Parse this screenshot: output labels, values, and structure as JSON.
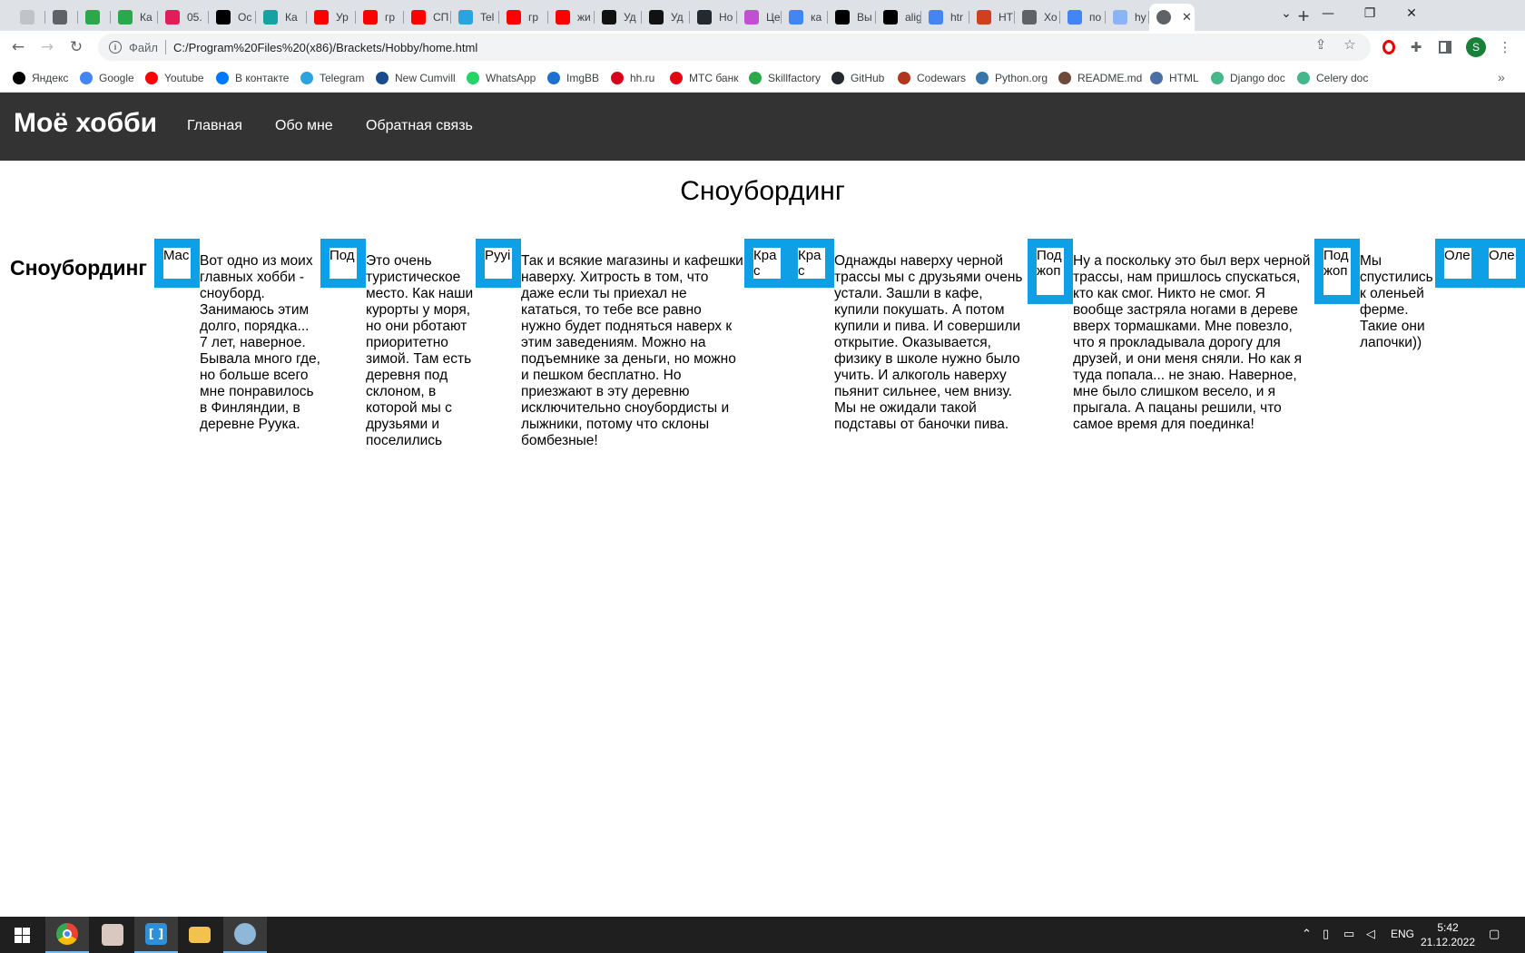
{
  "browser": {
    "tabs": [
      {
        "title": "",
        "icon": "app-icon",
        "color": "#c0c4c8"
      },
      {
        "title": "",
        "icon": "globe-icon",
        "color": "#5f6368"
      },
      {
        "title": "",
        "icon": "skillfactory-icon",
        "color": "#2ba84a"
      },
      {
        "title": "Ка",
        "icon": "skillfactory-icon",
        "color": "#2ba84a"
      },
      {
        "title": "05.",
        "icon": "slack-icon",
        "color": "#e01e5a"
      },
      {
        "title": "Ос",
        "icon": "medium-icon",
        "color": "#000000"
      },
      {
        "title": "Ка",
        "icon": "app-icon",
        "color": "#14a3a0"
      },
      {
        "title": "Ур",
        "icon": "youtube-icon",
        "color": "#ff0000"
      },
      {
        "title": "гр",
        "icon": "youtube-icon",
        "color": "#ff0000"
      },
      {
        "title": "СП",
        "icon": "youtube-icon",
        "color": "#ff0000"
      },
      {
        "title": "Tel",
        "icon": "telegram-icon",
        "color": "#2aa3df"
      },
      {
        "title": "гр",
        "icon": "youtube-icon",
        "color": "#ff0000"
      },
      {
        "title": "жи",
        "icon": "youtube-icon",
        "color": "#ff0000"
      },
      {
        "title": "Уд",
        "icon": "wp-icon",
        "color": "#111111"
      },
      {
        "title": "Уд",
        "icon": "wp-icon",
        "color": "#111111"
      },
      {
        "title": "Но",
        "icon": "github-icon",
        "color": "#24292f"
      },
      {
        "title": "Це",
        "icon": "color-wheel-icon",
        "color": "#c050d0"
      },
      {
        "title": "ка",
        "icon": "google-icon",
        "color": "#4285f4"
      },
      {
        "title": "Вы",
        "icon": "medium-icon",
        "color": "#000000"
      },
      {
        "title": "alig",
        "icon": "medium-icon",
        "color": "#000000"
      },
      {
        "title": "htr",
        "icon": "google-icon",
        "color": "#4285f4"
      },
      {
        "title": "HT",
        "icon": "html-icon",
        "color": "#d04020"
      },
      {
        "title": "Хо",
        "icon": "globe-icon",
        "color": "#5f6368"
      },
      {
        "title": "по",
        "icon": "google-icon",
        "color": "#4285f4"
      },
      {
        "title": "hy",
        "icon": "loading-icon",
        "color": "#8ab4f8"
      }
    ],
    "active_tab": {
      "icon": "globe-icon",
      "close": "✕"
    },
    "window": {
      "minimize": "—",
      "maximize": "❐",
      "close": "✕",
      "tab_search": "⌄",
      "new_tab": "+"
    },
    "address": {
      "scheme_label": "Файл",
      "url": "C:/Program%20Files%20(x86)/Brackets/Hobby/home.html"
    },
    "profile_letter": "S",
    "bookmarks": [
      {
        "label": "Яндекс",
        "icon": "yandex-icon",
        "color": "#000000"
      },
      {
        "label": "Google",
        "icon": "google-icon",
        "color": "#4285f4"
      },
      {
        "label": "Youtube",
        "icon": "youtube-icon",
        "color": "#ff0000"
      },
      {
        "label": "В контакте",
        "icon": "vk-icon",
        "color": "#0077ff"
      },
      {
        "label": "Telegram",
        "icon": "telegram-icon",
        "color": "#2aa3df"
      },
      {
        "label": "New Cumvill",
        "icon": "cumvill-icon",
        "color": "#1a4b8c"
      },
      {
        "label": "WhatsApp",
        "icon": "whatsapp-icon",
        "color": "#25d366"
      },
      {
        "label": "ImgBB",
        "icon": "imgbb-icon",
        "color": "#1d6fd1"
      },
      {
        "label": "hh.ru",
        "icon": "hh-icon",
        "color": "#d6001c"
      },
      {
        "label": "МТС банк",
        "icon": "mts-icon",
        "color": "#e30611"
      },
      {
        "label": "Skillfactory",
        "icon": "skillfactory-icon",
        "color": "#2ba84a"
      },
      {
        "label": "GitHub",
        "icon": "github-icon",
        "color": "#24292f"
      },
      {
        "label": "Codewars",
        "icon": "codewars-icon",
        "color": "#b1361e"
      },
      {
        "label": "Python.org",
        "icon": "python-icon",
        "color": "#3776ab"
      },
      {
        "label": "README.md",
        "icon": "readme-icon",
        "color": "#6e4a3a"
      },
      {
        "label": "HTML",
        "icon": "html-icon",
        "color": "#4a6fa5"
      },
      {
        "label": "Django doc",
        "icon": "django-icon",
        "color": "#44b78b"
      },
      {
        "label": "Celery doc",
        "icon": "celery-icon",
        "color": "#44b78b"
      }
    ]
  },
  "site": {
    "logo": "Моё хобби",
    "nav": [
      "Главная",
      "Обо мне",
      "Обратная связь"
    ],
    "page_title": "Сноубординг",
    "side_heading": "Сноубординг",
    "image_alts": [
      "Mac",
      "Под",
      "Рууі",
      "Крас",
      "Крас",
      "Под жоп",
      "Под жоп",
      "Оле",
      "Оле"
    ],
    "paragraphs": [
      "Вот одно из моих главных хобби - сноуборд. Занимаюсь этим долго, порядка... 7 лет, наверное. Бывала много где, но больше всего мне понравилось в Финляндии, в деревне Руука.",
      "Это очень туристическое место. Как наши курорты у моря, но они рботают приоритетно зимой. Там есть деревня под склоном, в которой мы с друзьями и поселились",
      "Так и всякие магазины и кафешки наверху. Хитрость в том, что даже если ты приехал не кататься, то тебе все равно нужно будет подняться наверх к этим заведениям. Можно на подъемнике за деньги, но можно и пешком бесплатно. Но приезжают в эту деревню исключительно сноубордисты и лыжники, потому что склоны бомбезные!",
      "Однажды наверху черной трассы мы с друзьями очень устали. Зашли в кафе, купили покушать. А потом купили и пива. И совершили открытие. Оказывается, физику в школе нужно было учить. И алкоголь наверху пьянит сильнее, чем внизу. Мы не ожидали такой подставы от баночки пива.",
      "Ну а поскольку это был верх черной трассы, нам пришлось спускаться, кто как смог. Никто не смог. Я вообще застряла ногами в дереве вверх тормашками. Мне повезло, что я прокладывала дорогу для друзей, и они меня сняли. Но как я туда попала... не знаю. Наверное, мне было слишком весело, и я прыгала. А пацаны решили, что самое время для поединка!",
      "Мы спустились к оленьей ферме. Такие они лапочки))"
    ]
  },
  "taskbar": {
    "apps": [
      {
        "icon": "windows-start-icon",
        "color": "#ffffff"
      },
      {
        "icon": "chrome-icon",
        "color": "#4285f4"
      },
      {
        "icon": "anime-app-icon",
        "color": "#d8c8c0"
      },
      {
        "icon": "brackets-icon",
        "color": "#2f8fd8"
      },
      {
        "icon": "file-explorer-icon",
        "color": "#f2c14e"
      },
      {
        "icon": "paint-icon",
        "color": "#8fb8d8"
      }
    ],
    "language": "ENG",
    "time": "5:42",
    "date": "21.12.2022"
  }
}
